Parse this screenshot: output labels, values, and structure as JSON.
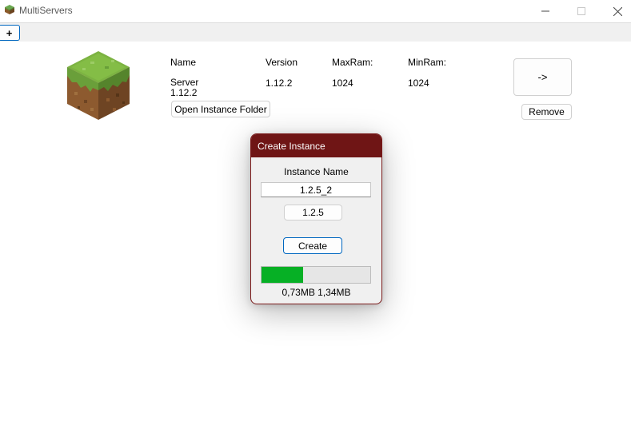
{
  "window": {
    "title": "MultiServers",
    "minimize_icon": "minimize-icon",
    "maximize_icon": "maximize-icon",
    "close_icon": "close-icon"
  },
  "toolbar": {
    "add_label": "+"
  },
  "instance_list": {
    "headers": {
      "name": "Name",
      "version": "Version",
      "maxram": "MaxRam:",
      "minram": "MinRam:"
    },
    "items": [
      {
        "icon": "grass-block-icon",
        "name": "Server 1.12.2",
        "version": "1.12.2",
        "maxram": "1024",
        "minram": "1024",
        "open_folder_label": "Open Instance Folder",
        "launch_label": "->",
        "remove_label": "Remove"
      }
    ]
  },
  "dialog": {
    "title": "Create Instance",
    "instance_name_label": "Instance Name",
    "instance_name_value": "1.2.5_2",
    "version_label": "1.2.5",
    "create_label": "Create",
    "progress_fraction": 0.38,
    "progress_text": "0,73MB 1,34MB"
  },
  "colors": {
    "dialog_title_bg": "#6f1515",
    "progress_fill": "#06b025",
    "accent": "#0067c0"
  }
}
